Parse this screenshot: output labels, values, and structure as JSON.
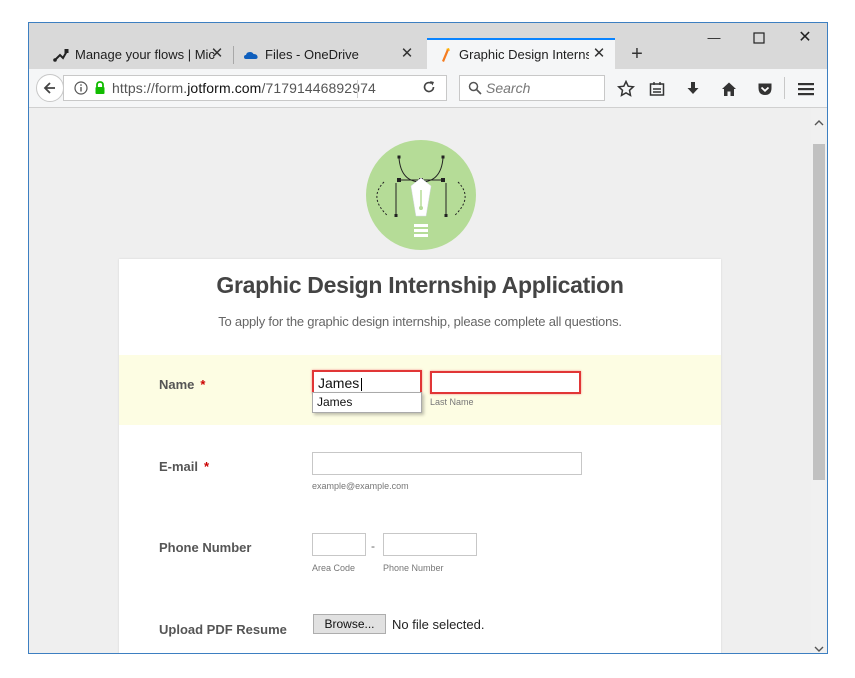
{
  "browser": {
    "tabs": [
      {
        "title": "Manage your flows | Mic",
        "icon": "flow-icon"
      },
      {
        "title": "Files - OneDrive",
        "icon": "onedrive-icon"
      },
      {
        "title": "Graphic Design Internshi",
        "icon": "jotform-icon",
        "active": true
      }
    ],
    "url_prefix": "https://form.",
    "url_domain": "jotform.com",
    "url_path": "/71791446892974",
    "search_placeholder": "Search",
    "accent_color": "#0a84ff"
  },
  "form": {
    "title": "Graphic Design Internship Application",
    "subtitle": "To apply for the graphic design internship, please complete all questions.",
    "name": {
      "label": "Name",
      "required_mark": "*",
      "first_value": "James",
      "last_value": "",
      "last_sublabel": "Last Name",
      "autocomplete_option": "James"
    },
    "email": {
      "label": "E-mail",
      "required_mark": "*",
      "value": "",
      "sublabel": "example@example.com"
    },
    "phone": {
      "label": "Phone Number",
      "separator": "-",
      "area_sublabel": "Area Code",
      "number_sublabel": "Phone Number"
    },
    "resume": {
      "label": "Upload PDF Resume",
      "browse_label": "Browse...",
      "status": "No file selected."
    },
    "error_color": "#e13636",
    "highlight_color": "#fdfde3"
  }
}
